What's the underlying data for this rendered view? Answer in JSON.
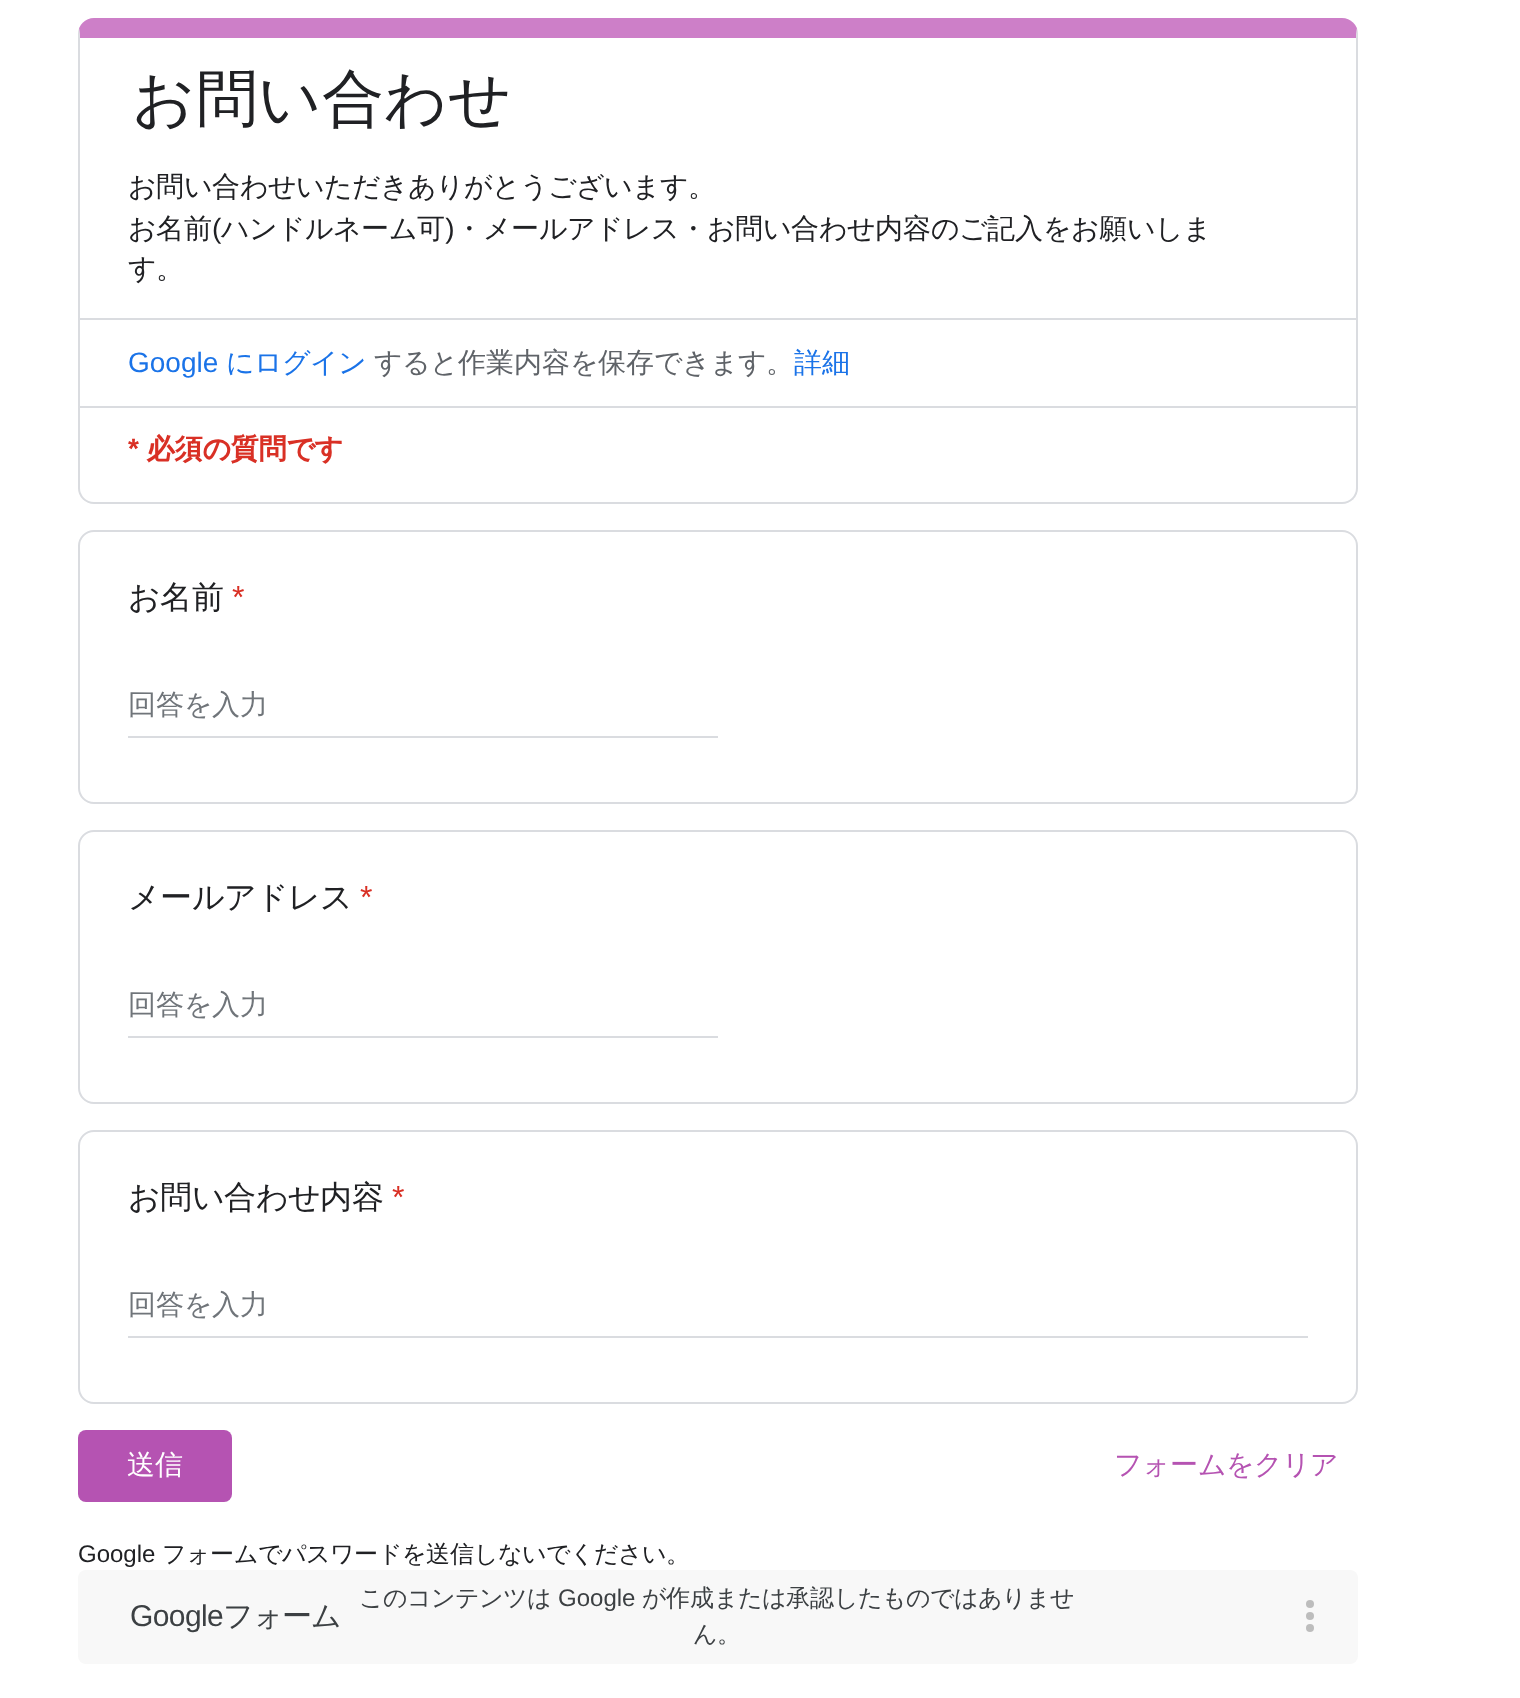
{
  "header": {
    "title": "お問い合わせ",
    "description": [
      "お問い合わせいただきありがとうございます。",
      "お名前(ハンドルネーム可)・メールアドレス・お問い合わせ内容のご記入をお願いします。"
    ],
    "sign_in": {
      "link": "Google にログイン",
      "text": "すると作業内容を保存できます。",
      "details_link": "詳細"
    },
    "required_note": "* 必須の質問です"
  },
  "questions": [
    {
      "label": "お名前",
      "required": true,
      "required_mark": "*",
      "kind": "short",
      "placeholder": "回答を入力"
    },
    {
      "label": "メールアドレス",
      "required": true,
      "required_mark": "*",
      "kind": "short",
      "placeholder": "回答を入力"
    },
    {
      "label": "お問い合わせ内容",
      "required": true,
      "required_mark": "*",
      "kind": "paragraph",
      "placeholder": "回答を入力"
    }
  ],
  "actions": {
    "submit": "送信",
    "clear": "フォームをクリア"
  },
  "footer": {
    "warning": "Google フォームでパスワードを送信しないでください。",
    "logo": "Googleフォーム",
    "disclaimer": "このコンテンツは Google が作成または承認したものではありません。"
  }
}
